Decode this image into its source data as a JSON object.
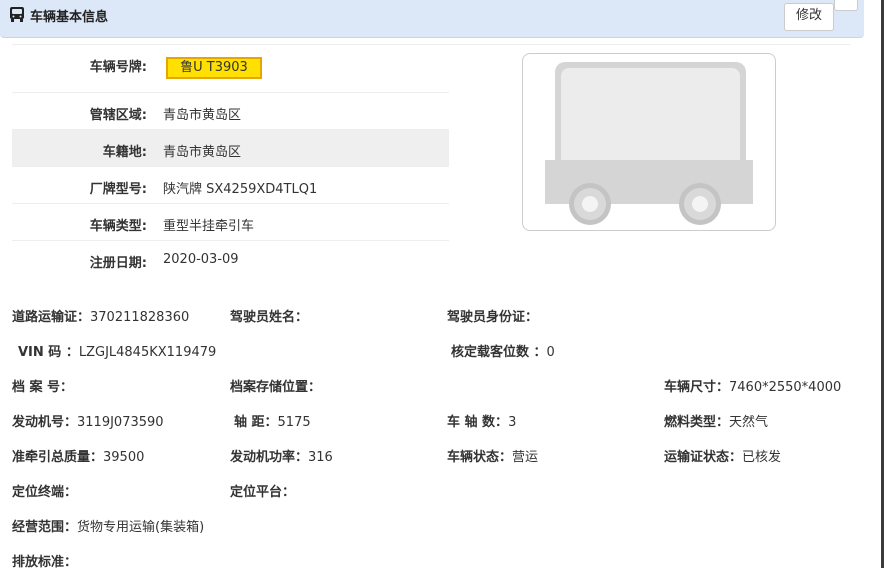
{
  "header": {
    "title": "车辆基本信息",
    "edit_label": "修改"
  },
  "info": {
    "plate_label": "车辆号牌:",
    "plate_value": "鲁U T3903",
    "region_label": "管辖区域:",
    "region_value": "青岛市黄岛区",
    "domicile_label": "车籍地:",
    "domicile_value": "青岛市黄岛区",
    "model_label": "厂牌型号:",
    "model_value": "陕汽牌 SX4259XD4TLQ1",
    "type_label": "车辆类型:",
    "type_value": "重型半挂牵引车",
    "regdate_label": "注册日期:",
    "regdate_value": "2020-03-09"
  },
  "details": {
    "road_permit_label": "道路运输证：",
    "road_permit_value": "370211828360",
    "driver_name_label": "驾驶员姓名：",
    "driver_name_value": "",
    "driver_id_label": "驾驶员身份证：",
    "driver_id_value": "",
    "vin_label": "VIN 码 ：",
    "vin_value": "LZGJL4845KX119479",
    "seats_label": "核定载客位数 ：",
    "seats_value": "0",
    "file_no_label": "档 案 号：",
    "file_no_value": "",
    "file_loc_label": "档案存储位置：",
    "file_loc_value": "",
    "size_label": "车辆尺寸：",
    "size_value": "7460*2550*4000",
    "engine_no_label": "发动机号：",
    "engine_no_value": "3119J073590",
    "wheelbase_label": "轴 距：",
    "wheelbase_value": "5175",
    "axles_label": "车 轴 数：",
    "axles_value": "3",
    "fuel_label": "燃料类型：",
    "fuel_value": "天然气",
    "tow_mass_label": "准牵引总质量：",
    "tow_mass_value": "39500",
    "power_label": "发动机功率：",
    "power_value": "316",
    "status_label": "车辆状态：",
    "status_value": "营运",
    "permit_status_label": "运输证状态：",
    "permit_status_value": "已核发",
    "gps_term_label": "定位终端：",
    "gps_term_value": "",
    "gps_platform_label": "定位平台：",
    "gps_platform_value": "",
    "scope_label": "经营范围：",
    "scope_value": "货物专用运输(集装箱)",
    "emission_label": "排放标准：",
    "emission_value": ""
  },
  "colors": {
    "header_bg": "#dce7f7",
    "plate_bg": "#ffe000",
    "plate_border": "#e6a600",
    "alt_row_bg": "#efefef"
  },
  "icons": {
    "header_icon": "vehicle-icon",
    "vehicle_image": "truck-placeholder-image"
  }
}
